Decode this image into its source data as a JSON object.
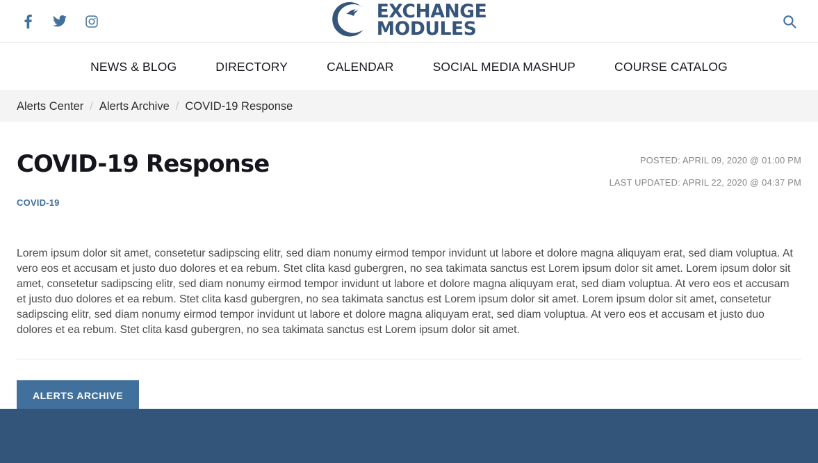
{
  "header": {
    "logo": {
      "line1": "EXCHANGE",
      "line2": "MODULES",
      "mark": "crescent-swoosh-logo-mark",
      "color": "#36557a"
    },
    "social": [
      {
        "name": "facebook",
        "label": "Facebook"
      },
      {
        "name": "twitter",
        "label": "Twitter"
      },
      {
        "name": "instagram",
        "label": "Instagram"
      }
    ],
    "search": {
      "icon": "search-icon",
      "label": "Search"
    }
  },
  "nav": {
    "items": [
      {
        "label": "NEWS & BLOG"
      },
      {
        "label": "DIRECTORY"
      },
      {
        "label": "CALENDAR"
      },
      {
        "label": "SOCIAL MEDIA MASHUP"
      },
      {
        "label": "COURSE CATALOG"
      }
    ]
  },
  "breadcrumb": {
    "separator": "/",
    "items": [
      {
        "label": "Alerts Center",
        "current": false
      },
      {
        "label": "Alerts Archive",
        "current": false
      },
      {
        "label": "COVID-19 Response",
        "current": true
      }
    ]
  },
  "article": {
    "title": "COVID-19 Response",
    "category": "COVID-19",
    "posted": "POSTED: APRIL 09, 2020 @ 01:00 PM",
    "last_updated": "LAST UPDATED: APRIL 22, 2020 @ 04:37 PM",
    "body": "Lorem ipsum dolor sit amet, consetetur sadipscing elitr, sed diam nonumy eirmod tempor invidunt ut labore et dolore magna aliquyam erat, sed diam voluptua. At vero eos et accusam et justo duo dolores et ea rebum. Stet clita kasd gubergren, no sea takimata sanctus est Lorem ipsum dolor sit amet. Lorem ipsum dolor sit amet, consetetur sadipscing elitr, sed diam nonumy eirmod tempor invidunt ut labore et dolore magna aliquyam erat, sed diam voluptua. At vero eos et accusam et justo duo dolores et ea rebum. Stet clita kasd gubergren, no sea takimata sanctus est Lorem ipsum dolor sit amet. Lorem ipsum dolor sit amet, consetetur sadipscing elitr, sed diam nonumy eirmod tempor invidunt ut labore et dolore magna aliquyam erat, sed diam voluptua. At vero eos et accusam et justo duo dolores et ea rebum. Stet clita kasd gubergren, no sea takimata sanctus est Lorem ipsum dolor sit amet.",
    "archive_button": "ALERTS ARCHIVE"
  },
  "theme": {
    "brand_blue": "#41709c",
    "logo_blue": "#36557a",
    "footer_blue": "#34557a",
    "breadcrumb_bg": "#f4f4f4",
    "body_text": "#4b4b4f",
    "meta_text": "#84868a"
  }
}
